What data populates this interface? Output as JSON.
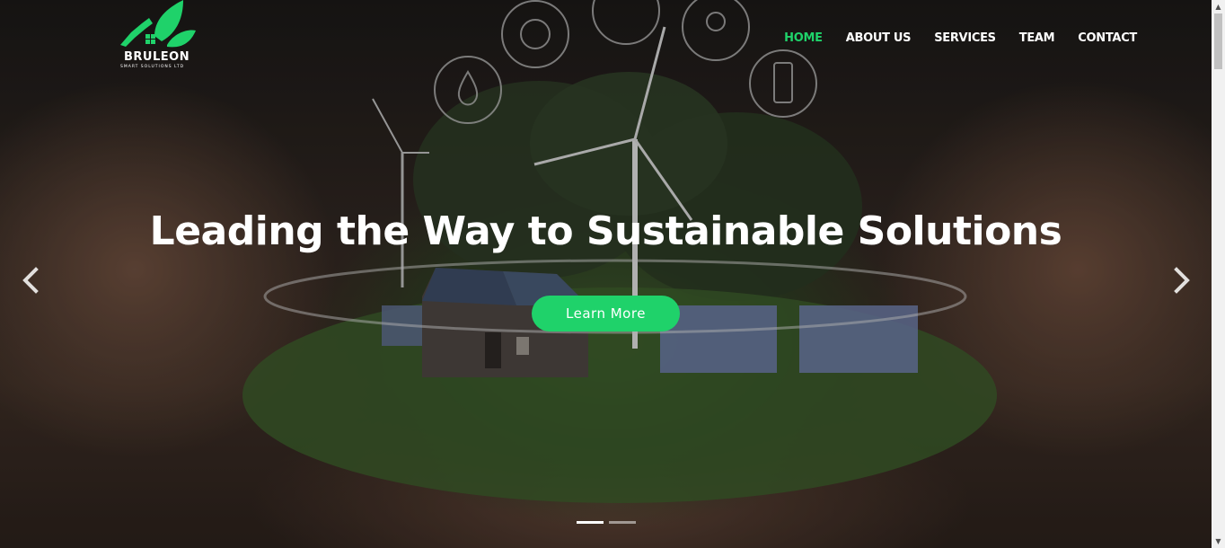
{
  "brand": {
    "name": "BRULEON",
    "tagline": "SMART SOLUTIONS LTD",
    "accent_color": "#1fd26a"
  },
  "nav": {
    "items": [
      {
        "label": "HOME",
        "active": true
      },
      {
        "label": "ABOUT US",
        "active": false
      },
      {
        "label": "SERVICES",
        "active": false
      },
      {
        "label": "TEAM",
        "active": false
      },
      {
        "label": "CONTACT",
        "active": false
      }
    ]
  },
  "hero": {
    "headline": "Leading the Way to Sustainable Solutions",
    "cta_label": "Learn More",
    "background_icons": [
      "sun-icon",
      "leaf-icon",
      "lightbulb-icon",
      "water-drop-icon",
      "battery-icon"
    ],
    "prev_icon": "chevron-left-icon",
    "next_icon": "chevron-right-icon",
    "slide_count": 2,
    "active_slide": 1
  },
  "scrollbar": {
    "up_icon": "▲",
    "down_icon": "▼"
  }
}
